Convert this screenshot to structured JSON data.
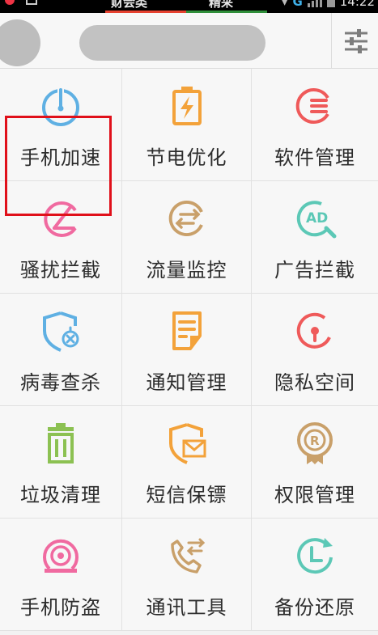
{
  "status_bar": {
    "title": "财会类",
    "tab2": "精采",
    "network": "G",
    "time": "14:22"
  },
  "colors": {
    "blue": "#5fb0e3",
    "orange": "#f3a23a",
    "red": "#ef5a5a",
    "pink": "#f06aa0",
    "tan": "#c9a06a",
    "teal": "#5cc8b6",
    "green": "#8cc152",
    "highlight": "#e0101a"
  },
  "grid": {
    "items": [
      {
        "label": "手机加速",
        "icon": "speedometer-icon"
      },
      {
        "label": "节电优化",
        "icon": "battery-bolt-icon"
      },
      {
        "label": "软件管理",
        "icon": "apps-list-icon"
      },
      {
        "label": "骚扰拦截",
        "icon": "block-icon"
      },
      {
        "label": "流量监控",
        "icon": "data-flow-icon"
      },
      {
        "label": "广告拦截",
        "icon": "ad-search-icon"
      },
      {
        "label": "病毒查杀",
        "icon": "shield-virus-icon"
      },
      {
        "label": "通知管理",
        "icon": "notification-doc-icon"
      },
      {
        "label": "隐私空间",
        "icon": "privacy-keyhole-icon"
      },
      {
        "label": "垃圾清理",
        "icon": "trash-icon"
      },
      {
        "label": "短信保镖",
        "icon": "sms-shield-icon"
      },
      {
        "label": "权限管理",
        "icon": "permission-badge-icon"
      },
      {
        "label": "手机防盗",
        "icon": "anti-theft-icon"
      },
      {
        "label": "通讯工具",
        "icon": "call-tools-icon"
      },
      {
        "label": "备份还原",
        "icon": "backup-clock-icon"
      }
    ]
  }
}
